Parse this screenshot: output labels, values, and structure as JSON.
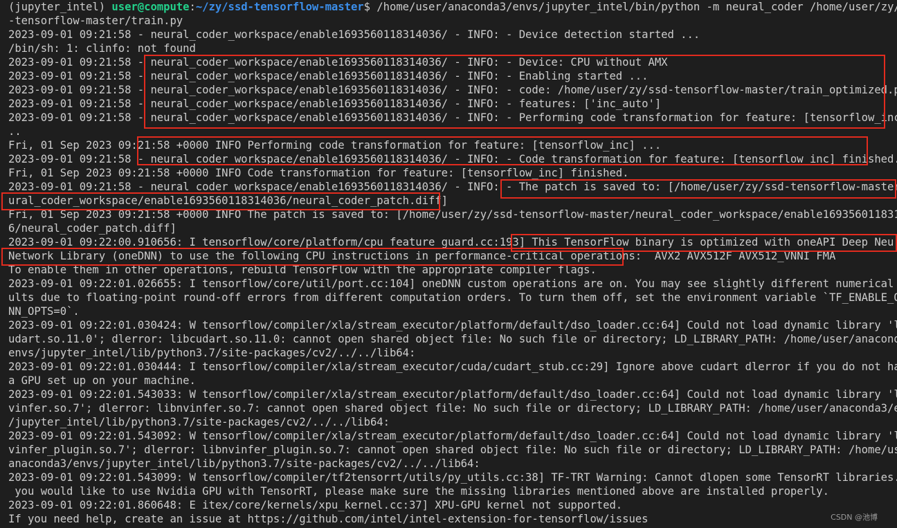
{
  "prompt": {
    "env": "(jupyter_intel)",
    "user_host": "user@compute",
    "sep": ":",
    "path": "~/zy/ssd-tensorflow-master",
    "symbol": "$",
    "command": " /home/user/anaconda3/envs/jupyter_intel/bin/python -m neural_coder /home/user/zy/ssd"
  },
  "lines": [
    "-tensorflow-master/train.py",
    "2023-09-01 09:21:58 - neural_coder_workspace/enable1693560118314036/ - INFO: - Device detection started ...",
    "/bin/sh: 1: clinfo: not found",
    "2023-09-01 09:21:58 - neural_coder_workspace/enable1693560118314036/ - INFO: - Device: CPU without AMX",
    "2023-09-01 09:21:58 - neural_coder_workspace/enable1693560118314036/ - INFO: - Enabling started ...",
    "2023-09-01 09:21:58 - neural_coder_workspace/enable1693560118314036/ - INFO: - code: /home/user/zy/ssd-tensorflow-master/train_optimized.py",
    "2023-09-01 09:21:58 - neural_coder_workspace/enable1693560118314036/ - INFO: - features: ['inc_auto']",
    "2023-09-01 09:21:58 - neural_coder_workspace/enable1693560118314036/ - INFO: - Performing code transformation for feature: [tensorflow_inc] .",
    "..",
    "Fri, 01 Sep 2023 09:21:58 +0000 INFO Performing code transformation for feature: [tensorflow_inc] ...",
    "2023-09-01 09:21:58 - neural_coder_workspace/enable1693560118314036/ - INFO: - Code transformation for feature: [tensorflow_inc] finished.",
    "Fri, 01 Sep 2023 09:21:58 +0000 INFO Code transformation for feature: [tensorflow_inc] finished.",
    "2023-09-01 09:21:58 - neural_coder_workspace/enable1693560118314036/ - INFO: - The patch is saved to: [/home/user/zy/ssd-tensorflow-master/ne",
    "ural_coder_workspace/enable1693560118314036/neural_coder_patch.diff]",
    "Fri, 01 Sep 2023 09:21:58 +0000 INFO The patch is saved to: [/home/user/zy/ssd-tensorflow-master/neural_coder_workspace/enable169356011831403",
    "6/neural_coder_patch.diff]",
    "2023-09-01 09:22:00.910656: I tensorflow/core/platform/cpu_feature_guard.cc:193] This TensorFlow binary is optimized with oneAPI Deep Neural",
    "Network Library (oneDNN) to use the following CPU instructions in performance-critical operations:  AVX2 AVX512F AVX512_VNNI FMA",
    "To enable them in other operations, rebuild TensorFlow with the appropriate compiler flags.",
    "2023-09-01 09:22:01.026655: I tensorflow/core/util/port.cc:104] oneDNN custom operations are on. You may see slightly different numerical res",
    "ults due to floating-point round-off errors from different computation orders. To turn them off, set the environment variable `TF_ENABLE_ONED",
    "NN_OPTS=0`.",
    "2023-09-01 09:22:01.030424: W tensorflow/compiler/xla/stream_executor/platform/default/dso_loader.cc:64] Could not load dynamic library 'libc",
    "udart.so.11.0'; dlerror: libcudart.so.11.0: cannot open shared object file: No such file or directory; LD_LIBRARY_PATH: /home/user/anaconda3/",
    "envs/jupyter_intel/lib/python3.7/site-packages/cv2/../../lib64:",
    "2023-09-01 09:22:01.030444: I tensorflow/compiler/xla/stream_executor/cuda/cudart_stub.cc:29] Ignore above cudart dlerror if you do not have",
    "a GPU set up on your machine.",
    "2023-09-01 09:22:01.543033: W tensorflow/compiler/xla/stream_executor/platform/default/dso_loader.cc:64] Could not load dynamic library 'libn",
    "vinfer.so.7'; dlerror: libnvinfer.so.7: cannot open shared object file: No such file or directory; LD_LIBRARY_PATH: /home/user/anaconda3/envs",
    "/jupyter_intel/lib/python3.7/site-packages/cv2/../../lib64:",
    "2023-09-01 09:22:01.543092: W tensorflow/compiler/xla/stream_executor/platform/default/dso_loader.cc:64] Could not load dynamic library 'libn",
    "vinfer_plugin.so.7'; dlerror: libnvinfer_plugin.so.7: cannot open shared object file: No such file or directory; LD_LIBRARY_PATH: /home/user/",
    "anaconda3/envs/jupyter_intel/lib/python3.7/site-packages/cv2/../../lib64:",
    "2023-09-01 09:22:01.543099: W tensorflow/compiler/tf2tensorrt/utils/py_utils.cc:38] TF-TRT Warning: Cannot dlopen some TensorRT libraries. If",
    " you would like to use Nvidia GPU with TensorRT, please make sure the missing libraries mentioned above are installed properly.",
    "2023-09-01 09:22:01.860648: E itex/core/kernels/xpu_kernel.cc:37] XPU-GPU kernel not supported.",
    "If you need help, create an issue at https://github.com/intel/intel-extension-for-tensorflow/issues"
  ],
  "highlight_color": "#e32b1e",
  "watermark": "CSDN @池博"
}
